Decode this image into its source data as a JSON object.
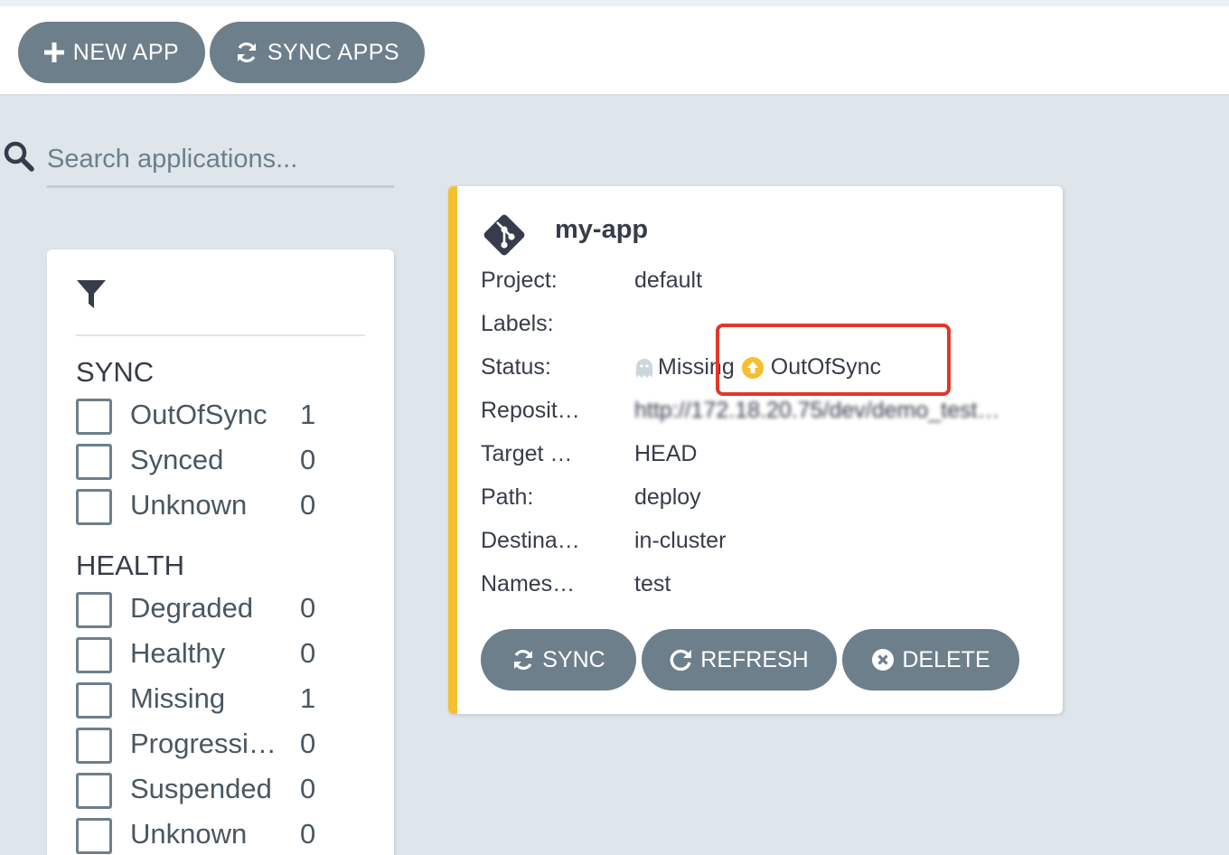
{
  "toolbar": {
    "new_app_label": "NEW APP",
    "sync_apps_label": "SYNC APPS"
  },
  "search": {
    "placeholder": "Search applications..."
  },
  "filters": {
    "sync_title": "SYNC",
    "sync_items": [
      {
        "label": "OutOfSync",
        "count": "1"
      },
      {
        "label": "Synced",
        "count": "0"
      },
      {
        "label": "Unknown",
        "count": "0"
      }
    ],
    "health_title": "HEALTH",
    "health_items": [
      {
        "label": "Degraded",
        "count": "0"
      },
      {
        "label": "Healthy",
        "count": "0"
      },
      {
        "label": "Missing",
        "count": "1"
      },
      {
        "label": "Progressi…",
        "count": "0"
      },
      {
        "label": "Suspended",
        "count": "0"
      },
      {
        "label": "Unknown",
        "count": "0"
      }
    ]
  },
  "app": {
    "name": "my-app",
    "fields": {
      "project_label": "Project:",
      "project_value": "default",
      "labels_label": "Labels:",
      "labels_value": "",
      "status_label": "Status:",
      "health_status": "Missing",
      "sync_status": "OutOfSync",
      "repo_label": "Reposit…",
      "repo_value": "http://172.18.20.75/dev/demo_test…",
      "target_label": "Target …",
      "target_value": "HEAD",
      "path_label": "Path:",
      "path_value": "deploy",
      "destination_label": "Destina…",
      "destination_value": "in-cluster",
      "namespace_label": "Names…",
      "namespace_value": "test"
    },
    "actions": {
      "sync_label": "SYNC",
      "refresh_label": "REFRESH",
      "delete_label": "DELETE"
    }
  },
  "colors": {
    "button_bg": "#6d7f8b",
    "card_accent": "#f4c030",
    "highlight": "#e0382a",
    "outofsync_icon": "#f4c030",
    "missing_icon": "#ccd6dd"
  }
}
